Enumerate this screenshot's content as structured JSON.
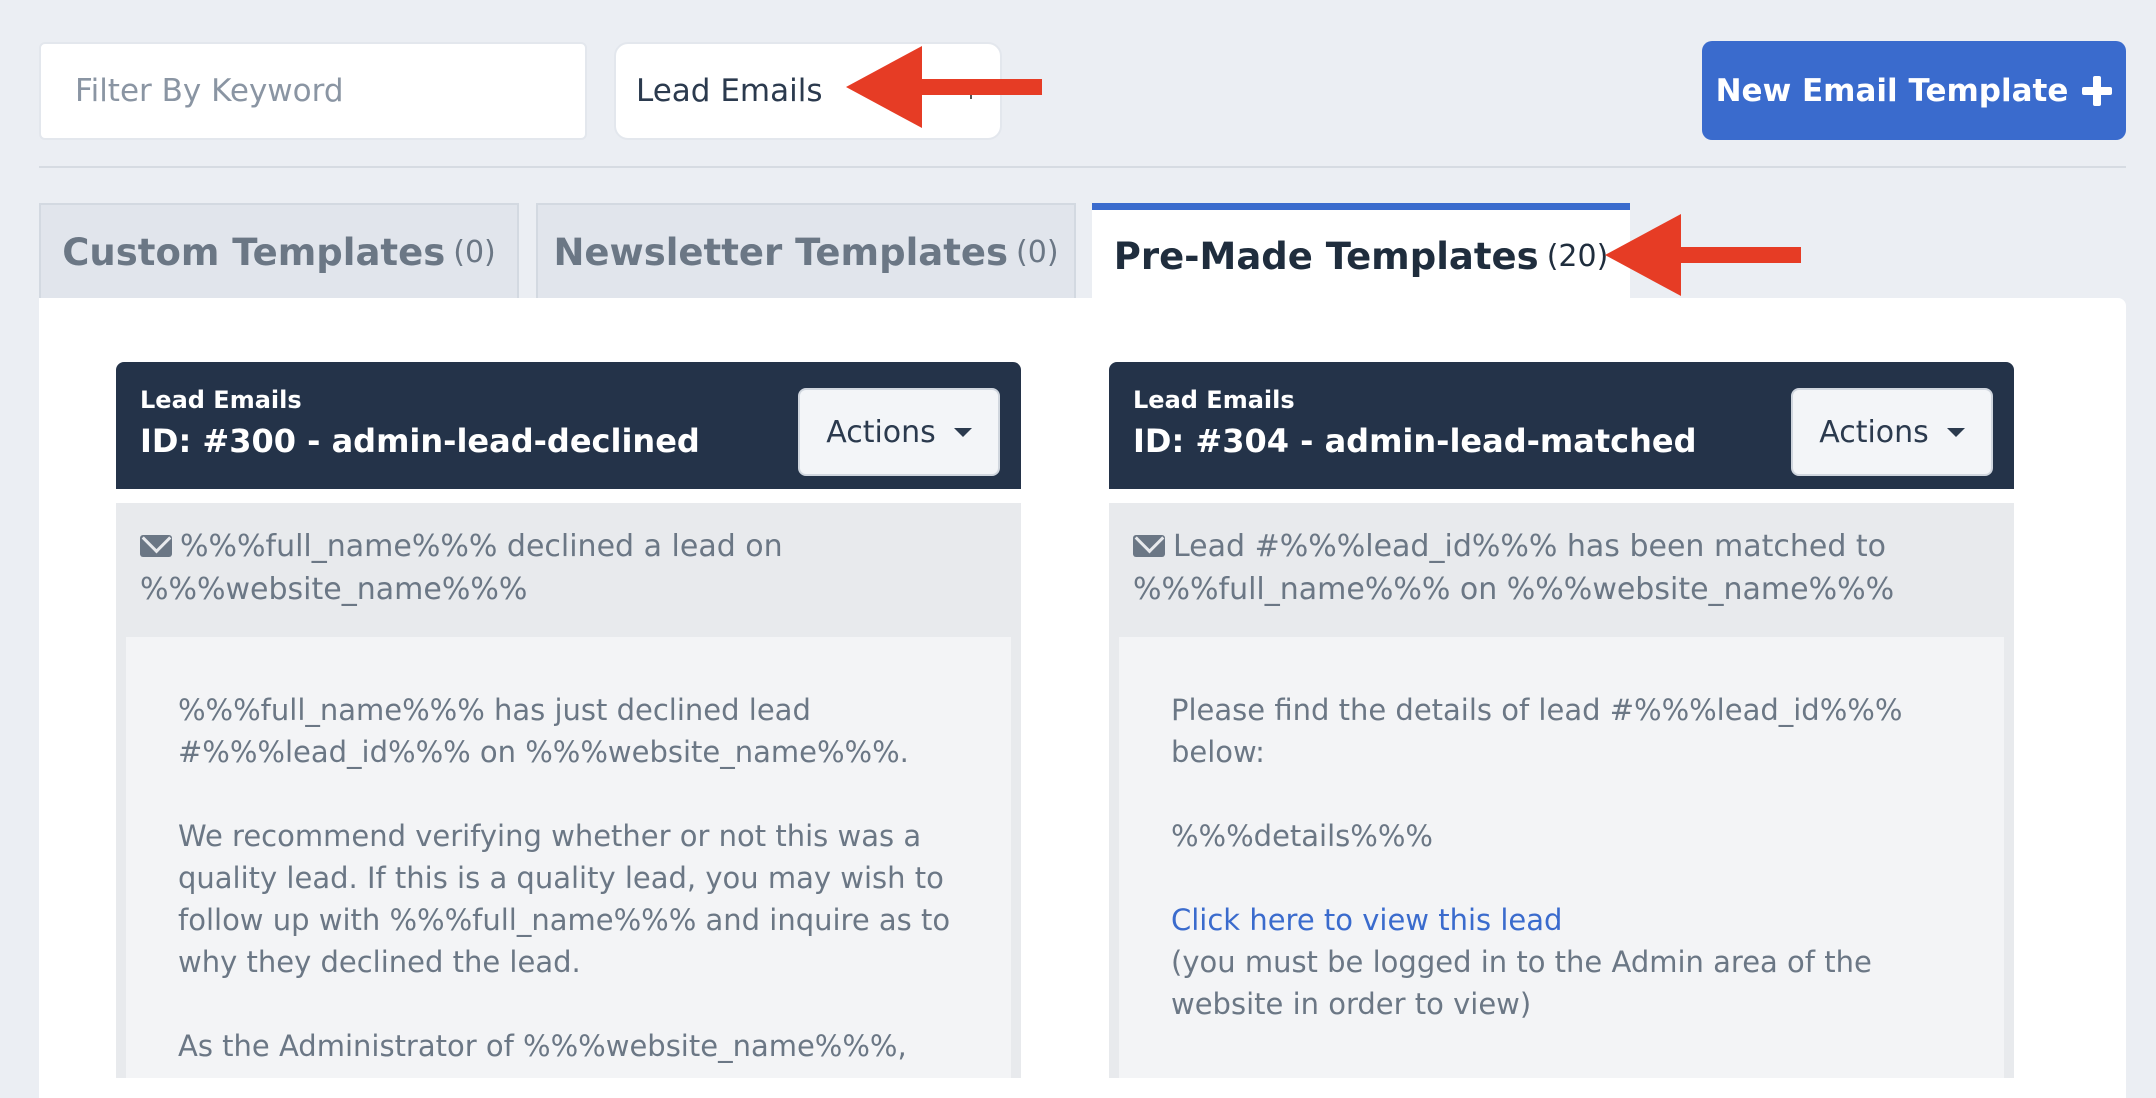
{
  "toolbar": {
    "filter_placeholder": "Filter By Keyword",
    "category_value": "Lead Emails",
    "new_button_label": "New Email Template"
  },
  "tabs": [
    {
      "label": "Custom Templates",
      "count": "(0)"
    },
    {
      "label": "Newsletter Templates",
      "count": "(0)"
    },
    {
      "label": "Pre-Made Templates",
      "count": "(20)"
    }
  ],
  "cards": [
    {
      "category": "Lead Emails",
      "id_line": "ID: #300 - admin-lead-declined",
      "actions_label": "Actions",
      "subject": "%%%full_name%%% declined a lead on %%%website_name%%%",
      "body_p1": "%%%full_name%%% has just declined lead #%%%lead_id%%% on %%%website_name%%%.",
      "body_p2": "We recommend verifying whether or not this was a quality lead. If this is a quality lead, you may wish to follow up with %%%full_name%%% and inquire as to why they declined the lead.",
      "body_p3": "As the Administrator of %%%website_name%%%, you"
    },
    {
      "category": "Lead Emails",
      "id_line": "ID: #304 - admin-lead-matched",
      "actions_label": "Actions",
      "subject": "Lead #%%%lead_id%%% has been matched to %%%full_name%%% on %%%website_name%%%",
      "body_p1": "Please find the details of lead #%%%lead_id%%% below:",
      "body_p2": "%%%details%%%",
      "link_text": "Click here to view this lead",
      "body_p3": "(you must be logged in to the Admin area of the website in order to view)"
    }
  ],
  "colors": {
    "accent": "#3a6bcd",
    "card_header": "#243349",
    "annotation_arrow": "#e63c25"
  }
}
